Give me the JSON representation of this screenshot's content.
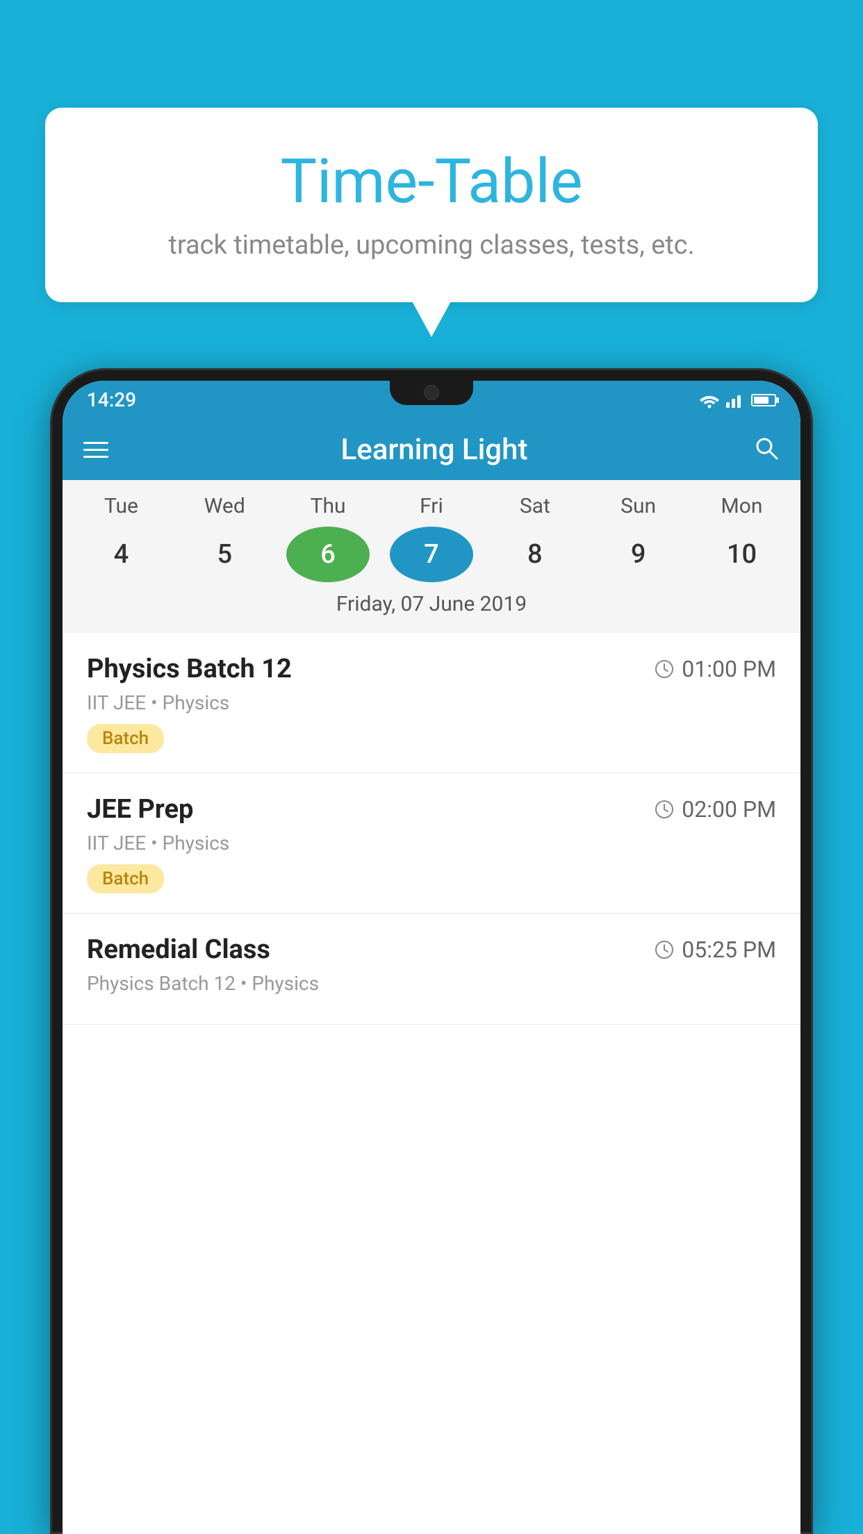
{
  "background_color": "#19b0d8",
  "speech_bubble": {
    "title": "Time-Table",
    "subtitle": "track timetable, upcoming classes, tests, etc."
  },
  "phone": {
    "status_bar": {
      "time": "14:29"
    },
    "app_bar": {
      "title": "Learning Light"
    },
    "calendar": {
      "days": [
        {
          "name": "Tue",
          "number": "4",
          "state": "normal"
        },
        {
          "name": "Wed",
          "number": "5",
          "state": "normal"
        },
        {
          "name": "Thu",
          "number": "6",
          "state": "today"
        },
        {
          "name": "Fri",
          "number": "7",
          "state": "selected"
        },
        {
          "name": "Sat",
          "number": "8",
          "state": "normal"
        },
        {
          "name": "Sun",
          "number": "9",
          "state": "normal"
        },
        {
          "name": "Mon",
          "number": "10",
          "state": "normal"
        }
      ],
      "selected_date_label": "Friday, 07 June 2019"
    },
    "schedule_items": [
      {
        "title": "Physics Batch 12",
        "time": "01:00 PM",
        "subtitle": "IIT JEE • Physics",
        "tag": "Batch"
      },
      {
        "title": "JEE Prep",
        "time": "02:00 PM",
        "subtitle": "IIT JEE • Physics",
        "tag": "Batch"
      },
      {
        "title": "Remedial Class",
        "time": "05:25 PM",
        "subtitle": "Physics Batch 12 • Physics",
        "tag": null
      }
    ]
  }
}
